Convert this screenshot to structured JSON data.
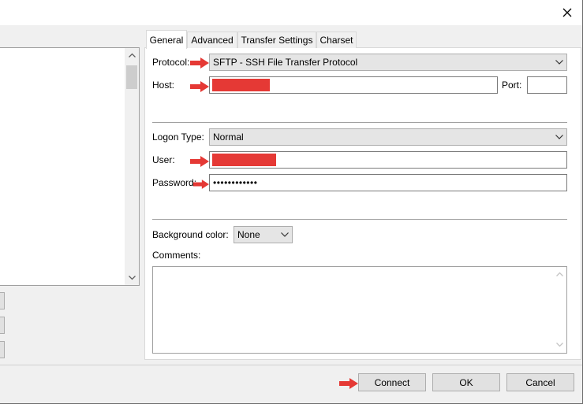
{
  "tabs": [
    {
      "label": "General"
    },
    {
      "label": "Advanced"
    },
    {
      "label": "Transfer Settings"
    },
    {
      "label": "Charset"
    }
  ],
  "general": {
    "protocol_label": "Protocol:",
    "protocol_value": "SFTP - SSH File Transfer Protocol",
    "host_label": "Host:",
    "host_value": "",
    "port_label": "Port:",
    "port_value": "",
    "logon_type_label": "Logon Type:",
    "logon_type_value": "Normal",
    "user_label": "User:",
    "user_value": "",
    "password_label": "Password:",
    "password_value": "••••••••••••",
    "background_color_label": "Background color:",
    "background_color_value": "None",
    "comments_label": "Comments:",
    "comments_value": ""
  },
  "buttons": {
    "connect": "Connect",
    "ok": "OK",
    "cancel": "Cancel"
  },
  "icons": {
    "close": "close-icon",
    "arrow": "red-arrow-icon",
    "chevron": "chevron-down-icon"
  },
  "colors": {
    "annotation_red": "#e53935",
    "panel_bg": "#ffffff",
    "window_bg": "#f0f0f0"
  }
}
